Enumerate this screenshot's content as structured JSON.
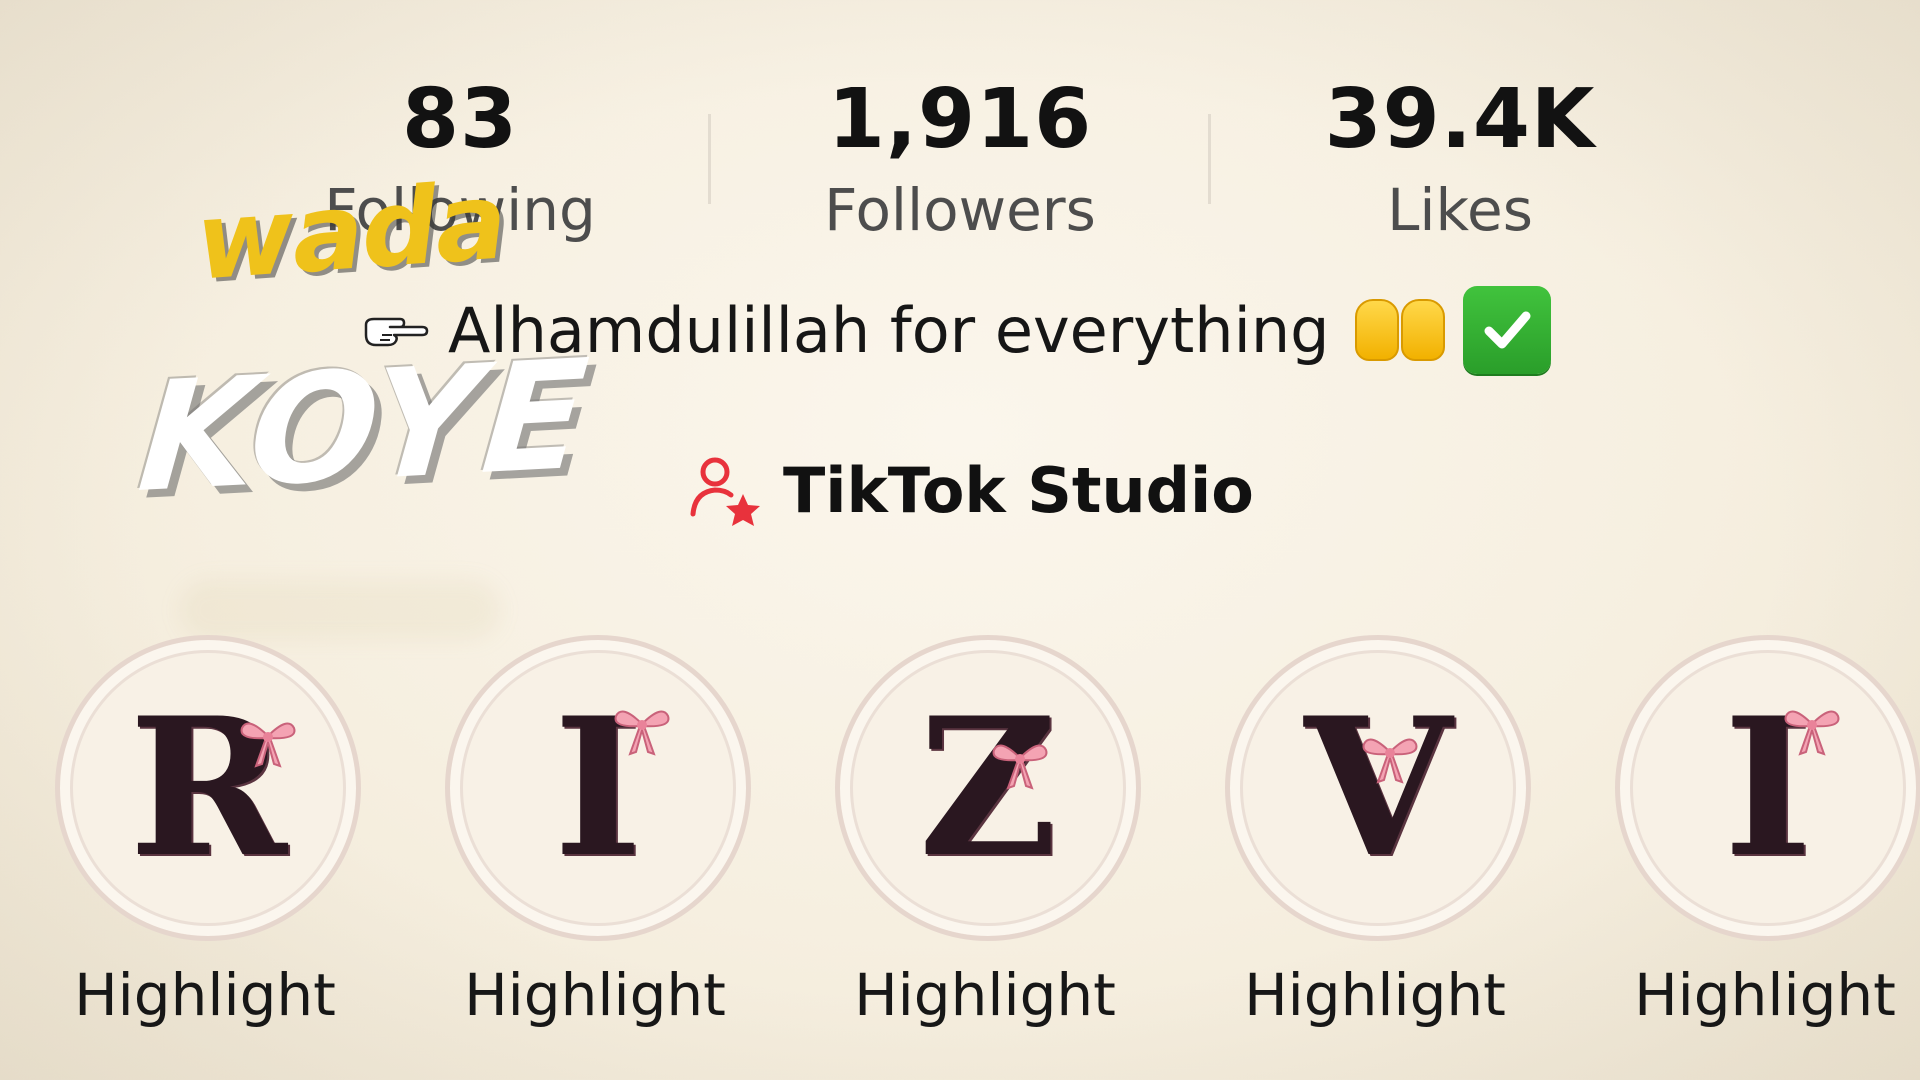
{
  "stats": {
    "following": {
      "value": "83",
      "label": "Following"
    },
    "followers": {
      "value": "1,916",
      "label": "Followers"
    },
    "likes": {
      "value": "39.4K",
      "label": "Likes"
    }
  },
  "watermark": {
    "line1": "wada",
    "line2": "KOYE"
  },
  "bio": {
    "text": "Alhamdulillah for everything",
    "leading_icon": "pointing-hand-icon",
    "trailing_icons": [
      "raising-hands-icon",
      "check-mark-button-icon"
    ]
  },
  "studio": {
    "label": "TikTok Studio",
    "icon": "creator-star-icon"
  },
  "highlights": [
    {
      "letter": "R",
      "label": "Highlight"
    },
    {
      "letter": "I",
      "label": "Highlight"
    },
    {
      "letter": "Z",
      "label": "Highlight"
    },
    {
      "letter": "V",
      "label": "Highlight"
    },
    {
      "letter": "I",
      "label": "Highlight"
    }
  ],
  "colors": {
    "background": "#f6efe0",
    "watermark_yellow": "#efc21b",
    "studio_icon_red": "#e8323c",
    "bow_pink": "#f4a3b3",
    "letter_dark": "#2a1720"
  }
}
